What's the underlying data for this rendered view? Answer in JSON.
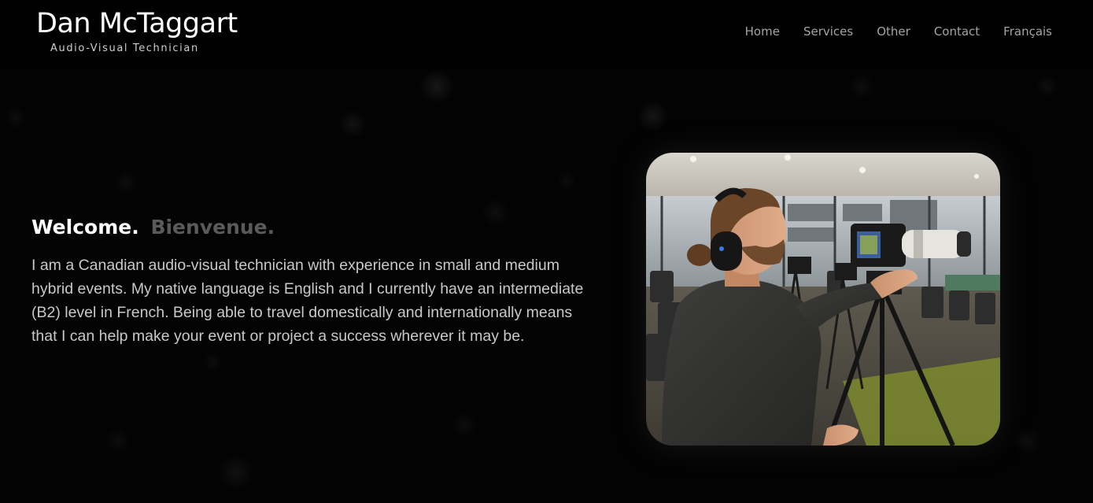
{
  "brand": {
    "name": "Dan McTaggart",
    "tagline": "Audio-Visual Technician"
  },
  "nav": {
    "items": [
      {
        "label": "Home"
      },
      {
        "label": "Services"
      },
      {
        "label": "Other"
      },
      {
        "label": "Contact"
      },
      {
        "label": "Français"
      }
    ]
  },
  "intro": {
    "heading_en": "Welcome.",
    "heading_fr": "Bienvenue.",
    "body": "I am a Canadian audio-visual technician with experience in small and medium hybrid events. My native language is English and I currently have an intermediate (B2) level in French. Being able to travel domestically and internationally means that I can help make your event or project a success wherever it may be."
  },
  "colors": {
    "background": "#030303",
    "heading_primary": "#ffffff",
    "heading_secondary": "#5a5a5a",
    "body_text": "#c9c9c9",
    "nav_text": "#a4a4a4"
  },
  "icons": {
    "photo": "technician-with-camera-photo"
  }
}
